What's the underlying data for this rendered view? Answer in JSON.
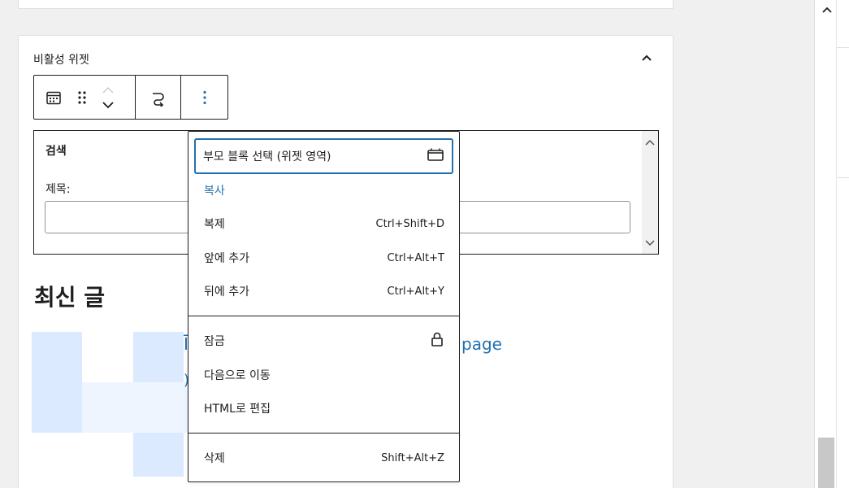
{
  "panel": {
    "title": "비활성 위젯"
  },
  "search_widget": {
    "title": "검색",
    "label": "제목:",
    "input_value": ""
  },
  "recent_posts": {
    "title": "최신 글",
    "link_left": "Ī",
    "link_right": "page",
    "link_paren": ")"
  },
  "menu": {
    "group1": [
      {
        "label": "부모 블록 선택 (위젯 영역)",
        "shortcut": "",
        "icon": "widget-area-icon"
      },
      {
        "label": "복사",
        "shortcut": ""
      },
      {
        "label": "복제",
        "shortcut": "Ctrl+Shift+D"
      },
      {
        "label": "앞에 추가",
        "shortcut": "Ctrl+Alt+T"
      },
      {
        "label": "뒤에 추가",
        "shortcut": "Ctrl+Alt+Y"
      }
    ],
    "group2": [
      {
        "label": "잠금",
        "shortcut": "",
        "icon": "lock-icon"
      },
      {
        "label": "다음으로 이동",
        "shortcut": ""
      },
      {
        "label": "HTML로 편집",
        "shortcut": ""
      }
    ],
    "group3": [
      {
        "label": "삭제",
        "shortcut": "Shift+Alt+Z"
      }
    ]
  },
  "colors": {
    "accent": "#2271b1",
    "text": "#1e1e1e",
    "border": "#1e1e1e",
    "background": "#f0f0f0"
  }
}
